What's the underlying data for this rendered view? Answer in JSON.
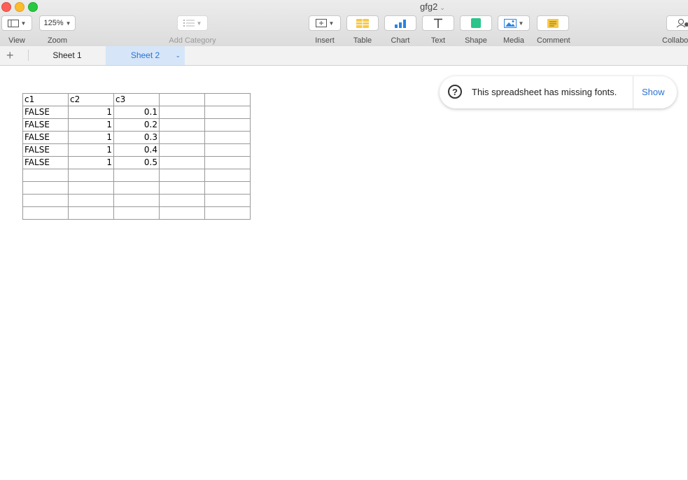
{
  "window": {
    "title": "gfg2"
  },
  "toolbar": {
    "view_label": "View",
    "zoom_label": "Zoom",
    "zoom_value": "125%",
    "add_category_label": "Add Category",
    "insert_label": "Insert",
    "table_label": "Table",
    "chart_label": "Chart",
    "text_label": "Text",
    "shape_label": "Shape",
    "media_label": "Media",
    "comment_label": "Comment",
    "collaborate_label": "Collabo",
    "colors": {
      "table": "#f7c948",
      "chart": "#2a84e0",
      "shape": "#2bc48a",
      "comment": "#f7c948"
    }
  },
  "sheets": {
    "tabs": [
      "Sheet 1",
      "Sheet 2"
    ],
    "active": "Sheet 2"
  },
  "table": {
    "rows": [
      [
        "c1",
        "c2",
        "c3",
        "",
        ""
      ],
      [
        "FALSE",
        "1",
        "0.1",
        "",
        ""
      ],
      [
        "FALSE",
        "1",
        "0.2",
        "",
        ""
      ],
      [
        "FALSE",
        "1",
        "0.3",
        "",
        ""
      ],
      [
        "FALSE",
        "1",
        "0.4",
        "",
        ""
      ],
      [
        "FALSE",
        "1",
        "0.5",
        "",
        ""
      ],
      [
        "",
        "",
        "",
        "",
        ""
      ],
      [
        "",
        "",
        "",
        "",
        ""
      ],
      [
        "",
        "",
        "",
        "",
        ""
      ],
      [
        "",
        "",
        "",
        "",
        ""
      ]
    ]
  },
  "notice": {
    "message": "This spreadsheet has missing fonts.",
    "action": "Show"
  }
}
